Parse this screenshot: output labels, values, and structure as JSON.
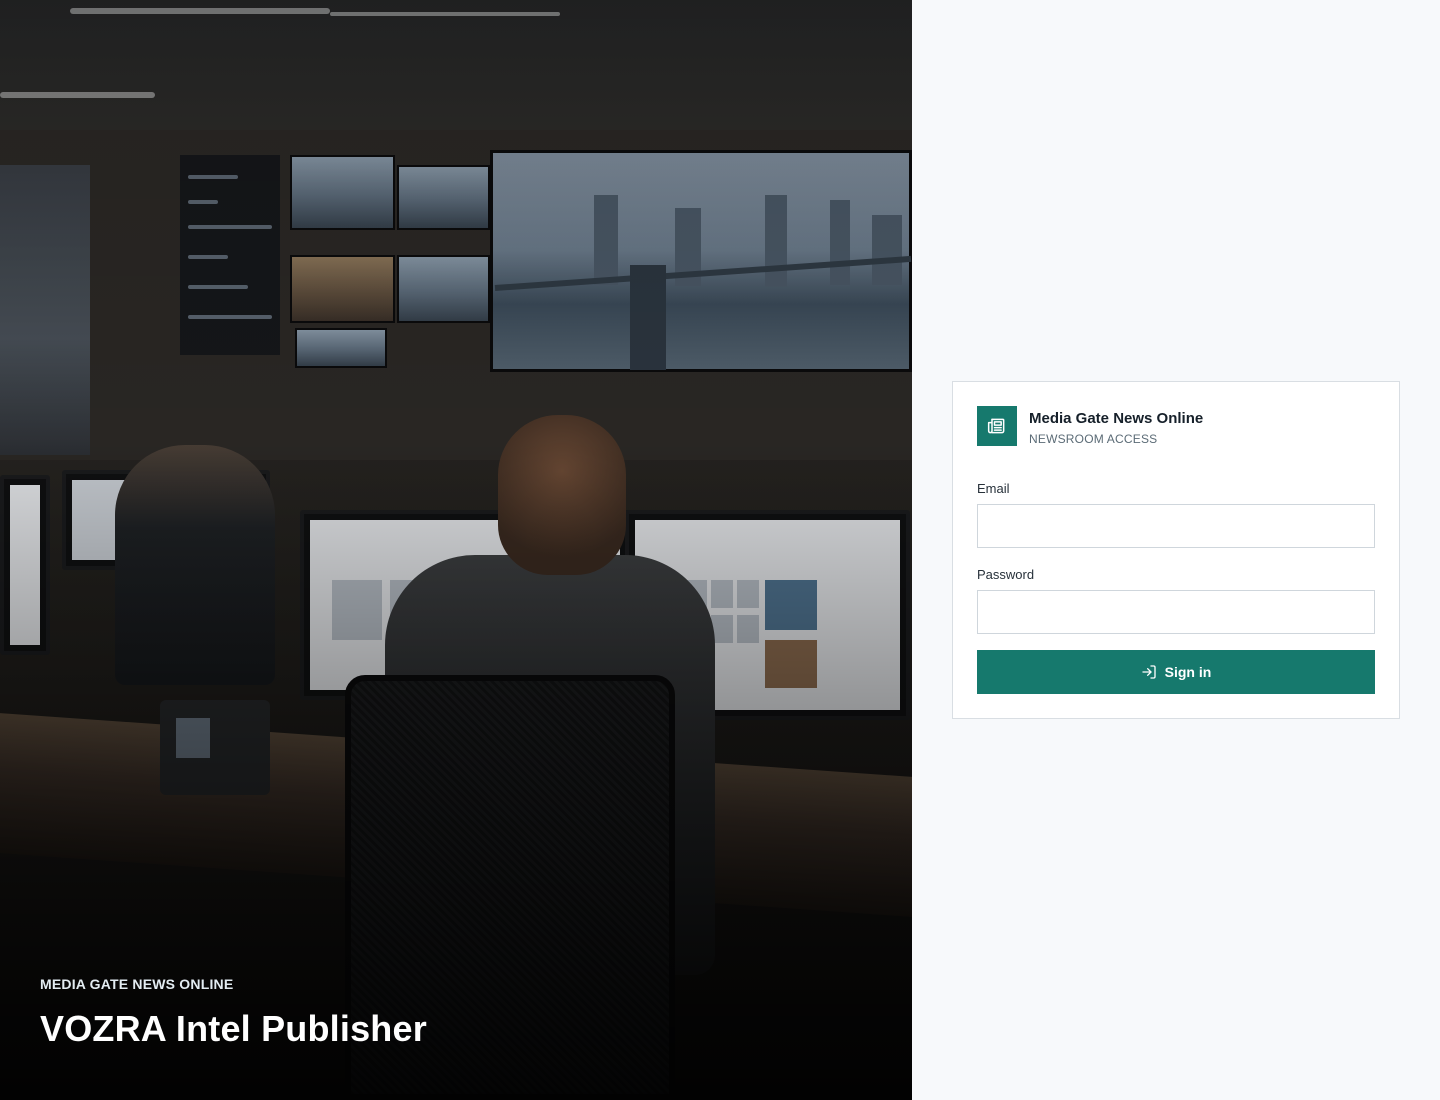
{
  "hero": {
    "kicker": "MEDIA GATE NEWS ONLINE",
    "title": "VOZRA Intel Publisher",
    "image": "newsroom-photo"
  },
  "card": {
    "brand_name": "Media Gate News Online",
    "brand_sub": "NEWSROOM ACCESS",
    "brand_icon": "newspaper-icon",
    "email_label": "Email",
    "email_value": "",
    "password_label": "Password",
    "password_value": "",
    "submit_label": "Sign in",
    "submit_icon": "sign-in-icon"
  },
  "colors": {
    "accent": "#16796d",
    "page_bg": "#f7f9fb",
    "card_border": "#d9dee3"
  }
}
